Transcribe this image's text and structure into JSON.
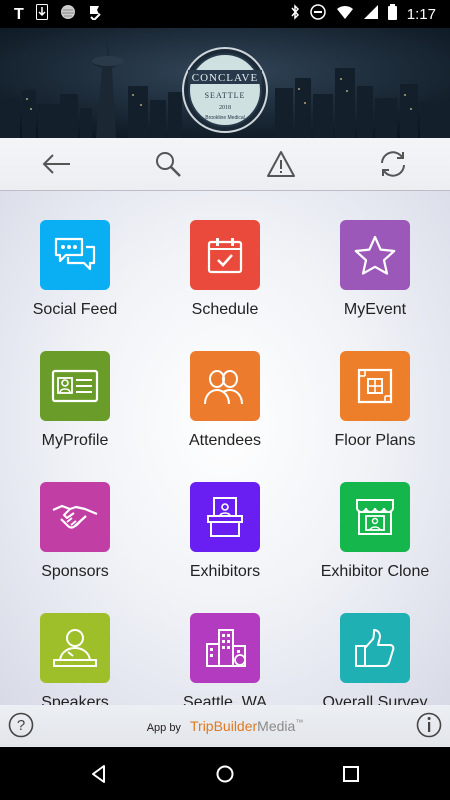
{
  "status_bar": {
    "time": "1:17",
    "left_icons": [
      "t-icon",
      "download-icon",
      "circle-icon",
      "check-flag-icon"
    ],
    "right_icons": [
      "bluetooth-icon",
      "minus-circle-icon",
      "wifi-icon",
      "signal-icon",
      "battery-icon"
    ]
  },
  "banner": {
    "logo_title": "CONCLAVE",
    "logo_subtitle": "SEATTLE",
    "logo_year": "2018",
    "logo_sponsor": "Brookline Medical"
  },
  "toolbar": {
    "buttons": [
      "back-arrow-icon",
      "search-icon",
      "alert-icon",
      "refresh-icon"
    ]
  },
  "tiles": [
    {
      "label": "Social Feed",
      "color": "#0aaef2",
      "icon": "chat-bubbles-icon"
    },
    {
      "label": "Schedule",
      "color": "#ea4a3c",
      "icon": "calendar-icon"
    },
    {
      "label": "MyEvent",
      "color": "#9c58b8",
      "icon": "star-icon"
    },
    {
      "label": "MyProfile",
      "color": "#6a9c2a",
      "icon": "id-card-icon"
    },
    {
      "label": "Attendees",
      "color": "#ed7b2d",
      "icon": "people-icon"
    },
    {
      "label": "Floor Plans",
      "color": "#ee7f2a",
      "icon": "floor-plan-icon"
    },
    {
      "label": "Sponsors",
      "color": "#c13ea5",
      "icon": "handshake-icon"
    },
    {
      "label": "Exhibitors",
      "color": "#6a1ff2",
      "icon": "booth-icon"
    },
    {
      "label": "Exhibitor Clone",
      "color": "#15b64c",
      "icon": "store-icon"
    },
    {
      "label": "Speakers",
      "color": "#9fbf2a",
      "icon": "speaker-icon"
    },
    {
      "label": "Seattle, WA",
      "color": "#b23bbf",
      "icon": "city-icon"
    },
    {
      "label": "Overall Survey",
      "color": "#1fb0b3",
      "icon": "thumbs-up-icon"
    }
  ],
  "footer": {
    "app_by": "App by",
    "brand_trip": "TripBuilder",
    "brand_media": "Media",
    "brand_tm": "™"
  },
  "nav_bar": [
    "back-triangle-icon",
    "home-circle-icon",
    "recents-square-icon"
  ]
}
